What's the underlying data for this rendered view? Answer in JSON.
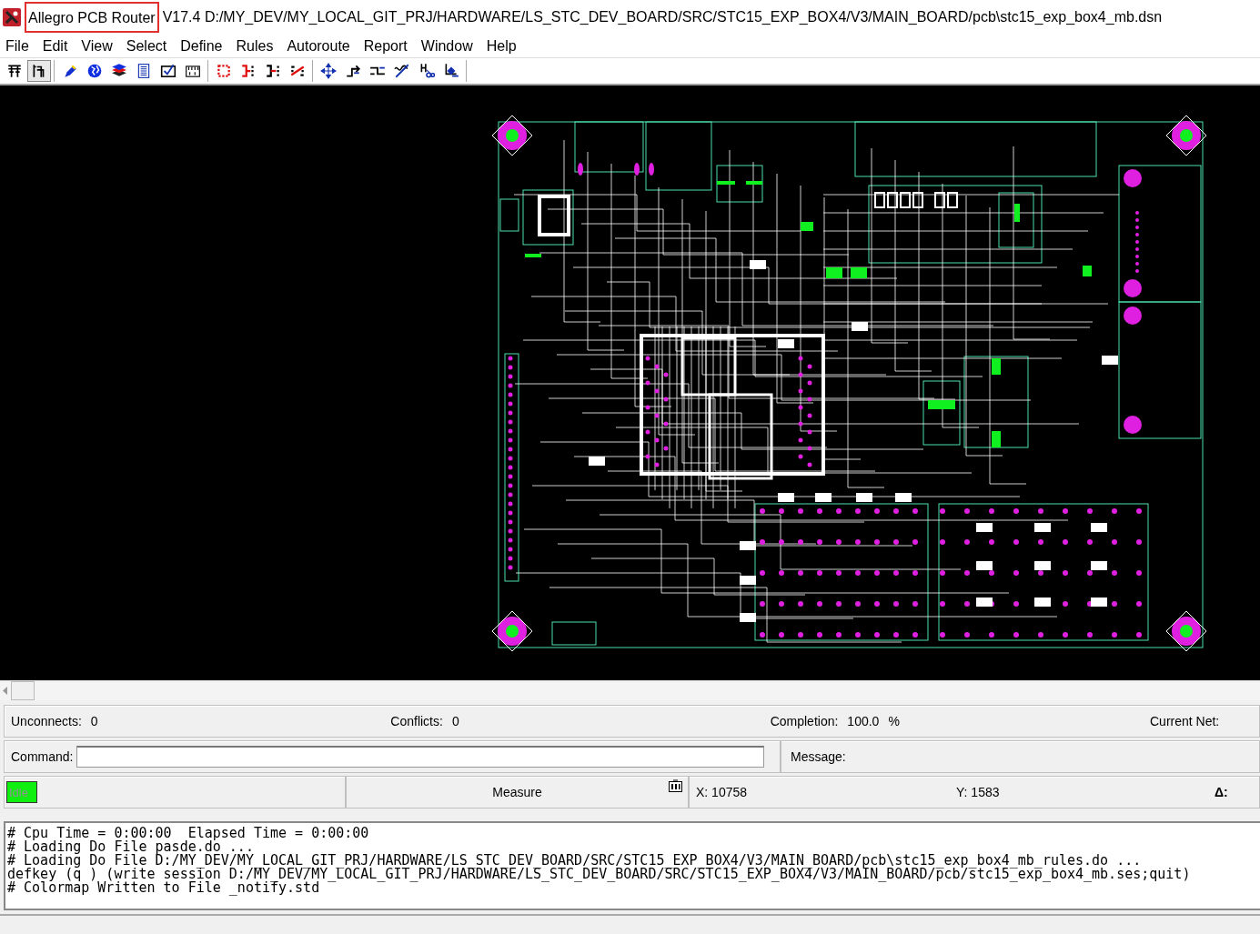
{
  "window": {
    "title_highlight": "Allegro PCB Router",
    "title_rest": "V17.4 D:/MY_DEV/MY_LOCAL_GIT_PRJ/HARDWARE/LS_STC_DEV_BOARD/SRC/STC15_EXP_BOX4/V3/MAIN_BOARD/pcb\\stc15_exp_box4_mb.dsn"
  },
  "menu": [
    "File",
    "Edit",
    "View",
    "Select",
    "Define",
    "Rules",
    "Autoroute",
    "Report",
    "Window",
    "Help"
  ],
  "toolbar": [
    [
      {
        "kind": "pins",
        "pressed": false
      },
      {
        "kind": "wires",
        "pressed": true
      }
    ],
    [
      {
        "kind": "pen",
        "pressed": false
      },
      {
        "kind": "globe",
        "pressed": false
      },
      {
        "kind": "layers",
        "pressed": false
      },
      {
        "kind": "doc",
        "pressed": false
      },
      {
        "kind": "check",
        "pressed": false
      },
      {
        "kind": "ruler",
        "pressed": false
      }
    ],
    [
      {
        "kind": "ring",
        "pressed": false
      },
      {
        "kind": "fanout",
        "pressed": false
      },
      {
        "kind": "fanout2",
        "pressed": false
      },
      {
        "kind": "cross",
        "pressed": false
      }
    ],
    [
      {
        "kind": "move",
        "pressed": false
      },
      {
        "kind": "step",
        "pressed": false
      },
      {
        "kind": "route",
        "pressed": false
      },
      {
        "kind": "wave",
        "pressed": false
      },
      {
        "kind": "scissors",
        "pressed": false
      },
      {
        "kind": "tool",
        "pressed": false
      }
    ]
  ],
  "status": {
    "unconnects_label": "Unconnects:",
    "unconnects": "0",
    "conflicts_label": "Conflicts:",
    "conflicts": "0",
    "completion_label": "Completion:",
    "completion": "100.0",
    "completion_unit": "%",
    "current_net_label": "Current Net:"
  },
  "command": {
    "label": "Command:",
    "message_label": "Message:"
  },
  "state": {
    "mode": "Idle",
    "active": true,
    "tool": "Measure",
    "x": "X: 10758",
    "y": "Y: 1583",
    "delta": "Δ:"
  },
  "console": [
    "# Cpu Time = 0:00:00  Elapsed Time = 0:00:00",
    "# Loading Do File pasde.do ...",
    "# Loading Do File D:/MY_DEV/MY_LOCAL_GIT_PRJ/HARDWARE/LS_STC_DEV_BOARD/SRC/STC15_EXP_BOX4/V3/MAIN_BOARD/pcb\\stc15_exp_box4_mb_rules.do ...",
    "defkey (q ) (write session D:/MY_DEV/MY_LOCAL_GIT_PRJ/HARDWARE/LS_STC_DEV_BOARD/SRC/STC15_EXP_BOX4/V3/MAIN_BOARD/pcb/stc15_exp_box4_mb.ses;quit)",
    "# Colormap Written to File _notify.std"
  ]
}
